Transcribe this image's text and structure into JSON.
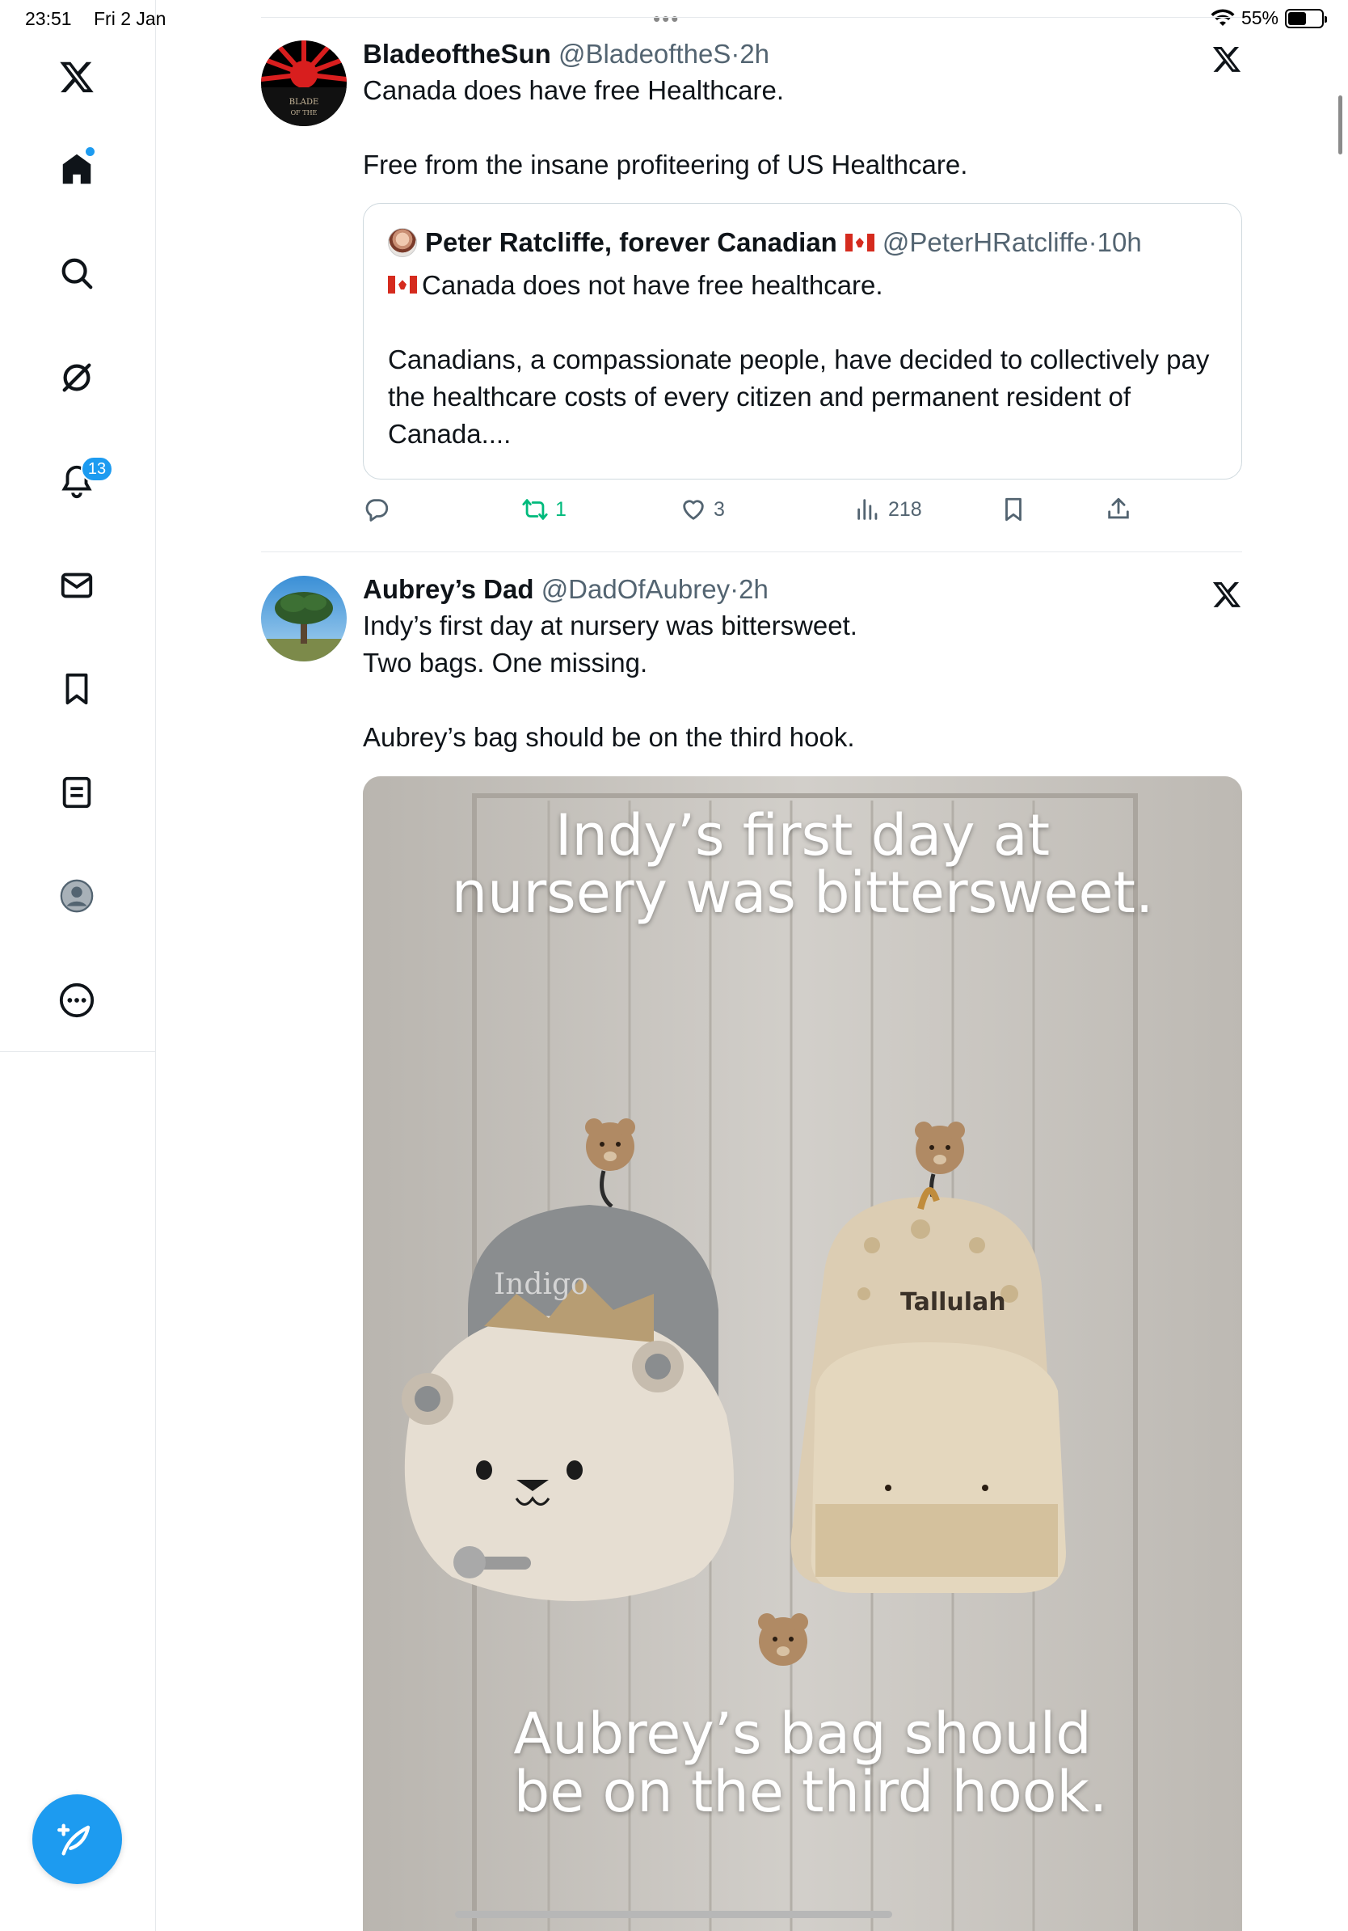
{
  "status_bar": {
    "time": "23:51",
    "date": "Fri 2 Jan",
    "dots": "•••",
    "battery_percent": "55%",
    "battery_level": 0.55
  },
  "sidebar": {
    "items": [
      {
        "name": "x-logo",
        "icon": "x-logo-icon"
      },
      {
        "name": "home",
        "icon": "home-icon"
      },
      {
        "name": "explore",
        "icon": "search-icon"
      },
      {
        "name": "grok",
        "icon": "grok-icon"
      },
      {
        "name": "notifications",
        "icon": "bell-icon"
      },
      {
        "name": "messages",
        "icon": "mail-icon"
      },
      {
        "name": "bookmarks",
        "icon": "bookmark-icon"
      },
      {
        "name": "lists",
        "icon": "list-icon"
      },
      {
        "name": "profile",
        "icon": "profile-icon"
      },
      {
        "name": "more",
        "icon": "more-icon"
      }
    ],
    "notification_count": "13",
    "compose_icon": "compose-icon"
  },
  "tweets": [
    {
      "name": "BladeoftheSun",
      "handle": "@BladeoftheS",
      "separator": "·",
      "time": "2h",
      "text": "Canada does have free Healthcare.\n\nFree from the insane profiteering of US Healthcare.",
      "quote": {
        "name": "Peter Ratcliffe, forever Canadian",
        "handle": "@PeterHRatcliffe",
        "separator": "·",
        "time": "10h",
        "text": "Canada does not have free healthcare.\n\nCanadians, a compassionate people,  have decided to collectively pay the healthcare costs of every citizen and permanent resident of Canada...."
      },
      "actions": {
        "replies": "",
        "retweets": "1",
        "likes": "3",
        "views": "218"
      }
    },
    {
      "name": "Aubrey’s Dad",
      "handle": "@DadOfAubrey",
      "separator": "·",
      "time": "2h",
      "text": "Indy’s first day at nursery was bittersweet.\nTwo bags. One missing.\n\nAubrey’s bag should be on the third hook.",
      "media": {
        "caption_top_1": "Indy’s first day at",
        "caption_top_2": "nursery was bittersweet.",
        "caption_bottom_1": "Aubrey’s bag should",
        "caption_bottom_2": "be on the third hook.",
        "bag_left_label": "Indigo",
        "bag_right_label": "Tallulah"
      }
    }
  ],
  "colors": {
    "accent": "#1d9bf0",
    "retweet_green": "#00ba7c",
    "muted": "#536471",
    "border": "#e6e9ec"
  }
}
